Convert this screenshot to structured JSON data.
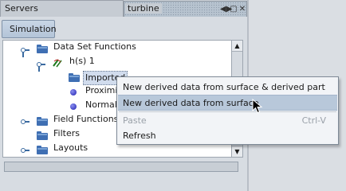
{
  "tabs": {
    "servers": "Servers",
    "turbine": "turbine",
    "controls": [
      "◀▶",
      "▢",
      "✕"
    ]
  },
  "toolbar": {
    "simulation_label": "Simulation"
  },
  "tree": {
    "data_set_functions": "Data Set Functions",
    "hs1": "h(s) 1",
    "imported": "Imported",
    "proximity": "Proximity",
    "normal_d": "Normal D",
    "field_functions": "Field Functions",
    "filters": "Filters",
    "layouts": "Layouts"
  },
  "context_menu": {
    "items": [
      {
        "label": "New derived data from surface & derived part",
        "enabled": true,
        "highlighted": false
      },
      {
        "label": "New derived data from surface",
        "enabled": true,
        "highlighted": true
      },
      {
        "label": "Paste",
        "enabled": false,
        "shortcut": "Ctrl-V"
      },
      {
        "label": "Refresh",
        "enabled": true
      }
    ]
  },
  "icons": {
    "folder": "folder-icon",
    "expand_handle": "tree-expand-handle-icon",
    "bullet": "bullet-icon",
    "function": "function-icon",
    "cursor": "mouse-pointer-icon"
  },
  "colors": {
    "selection": "#b8c8da",
    "folder": "#3f6fb3",
    "panel": "#d7dce2"
  }
}
